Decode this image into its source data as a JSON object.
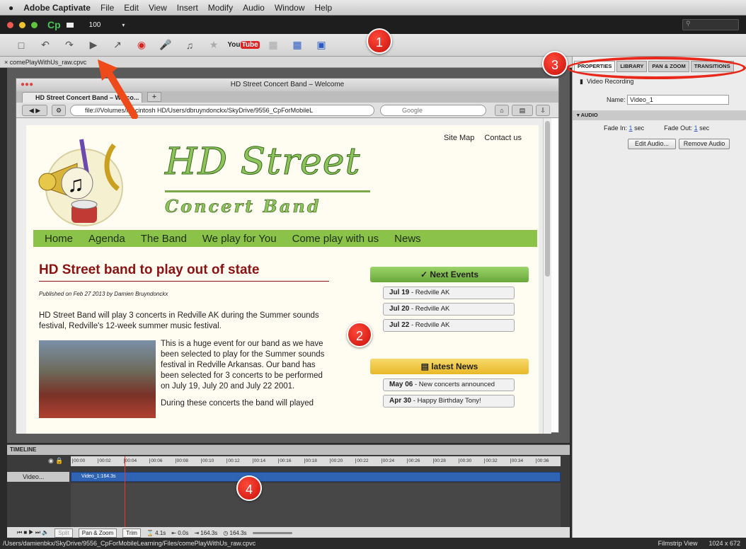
{
  "menubar": {
    "apple": "",
    "app": "Adobe Captivate",
    "items": [
      "File",
      "Edit",
      "View",
      "Insert",
      "Modify",
      "Audio",
      "Window",
      "Help"
    ]
  },
  "appbar": {
    "logo": "Cp",
    "zoom": "100"
  },
  "toolbar": {
    "youtube_a": "You",
    "youtube_b": "Tube"
  },
  "doc_tab": "× comePlayWithUs_raw.cpvc",
  "browser": {
    "window_title": "HD Street Concert Band – Welcome",
    "tab_title": "HD Street Concert Band – Welco...",
    "url": "file:///Volumes/Macintosh HD/Users/dbruyndonckx/SkyDrive/9556_CpForMobileL",
    "search_placeholder": "Google"
  },
  "site": {
    "top_links": [
      "Site Map",
      "Contact us"
    ],
    "brand_a": "HD Street",
    "brand_b": "Concert Band",
    "nav": [
      "Home",
      "Agenda",
      "The Band",
      "We play for You",
      "Come play with us",
      "News"
    ],
    "headline": "HD Street band to play out of state",
    "byline": "Published on Feb 27 2013 by Damien Bruyndonckx",
    "p1": "HD Street Band will play 3 concerts in Redville AK during the Summer sounds festival, Redville's 12-week summer music festival.",
    "p2": "This is a huge event for our band as we have been selected to play for the Summer sounds festival in Redville Arkansas. Our band has been selected for 3 concerts to be performed on July 19, July 20 and July 22 2001.",
    "p3": "During these concerts the band will played",
    "events_title": "Next Events",
    "events": [
      {
        "date": "Jul 19",
        "place": "- Redville AK"
      },
      {
        "date": "Jul 20",
        "place": "- Redville AK"
      },
      {
        "date": "Jul 22",
        "place": "- Redville AK"
      }
    ],
    "news_title": "latest News",
    "news": [
      {
        "date": "May 06",
        "text": "- New concerts announced"
      },
      {
        "date": "Apr 30",
        "text": "- Happy Birthday Tony!"
      }
    ]
  },
  "panel": {
    "tabs": [
      "PROPERTIES",
      "LIBRARY",
      "PAN & ZOOM",
      "TRANSITIONS"
    ],
    "type": "Video Recording",
    "name_label": "Name:",
    "name_value": "Video_1",
    "audio_header": "AUDIO",
    "fade_in_label": "Fade In:",
    "fade_in_value": "1",
    "fade_out_label": "Fade Out:",
    "fade_out_value": "1",
    "unit": "sec",
    "edit_audio": "Edit Audio...",
    "remove_audio": "Remove Audio"
  },
  "timeline": {
    "header": "TIMELINE",
    "ticks": [
      "00:00",
      "00:02",
      "00:04",
      "00:06",
      "00:08",
      "00:10",
      "00:12",
      "00:14",
      "00:16",
      "00:18",
      "00:20",
      "00:22",
      "00:24",
      "00:26",
      "00:28",
      "00:30",
      "00:32",
      "00:34",
      "00:36"
    ],
    "track_label": "Video...",
    "clip": "Video_1:164.3s",
    "foot_split": "Split",
    "foot_pan": "Pan & Zoom",
    "foot_trim": "Trim",
    "foot_dur": "4.1s",
    "foot_in": "0.0s",
    "foot_out": "164.3s",
    "foot_total": "164.3s"
  },
  "statusbar": {
    "path": "/Users/damienbkx/SkyDrive/9556_CpForMobileLearning/Files/comePlayWithUs_raw.cpvc",
    "view": "Filmstrip View",
    "size": "1024 x 672"
  },
  "callouts": [
    "1",
    "2",
    "3",
    "4"
  ]
}
